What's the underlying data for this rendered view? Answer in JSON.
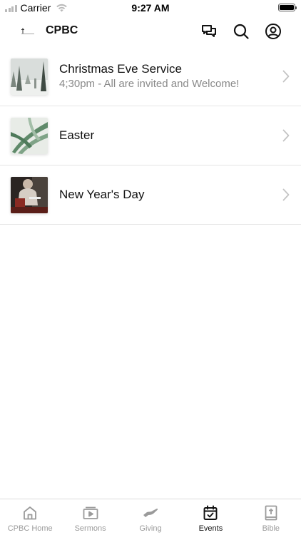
{
  "status_bar": {
    "carrier": "Carrier",
    "time": "9:27 AM"
  },
  "header": {
    "logo_text": "CPBC",
    "title": "CPBC"
  },
  "events": [
    {
      "title": "Christmas Eve Service",
      "subtitle": "4;30pm - All are invited and Welcome!",
      "thumbnail": "snowy-forest"
    },
    {
      "title": "Easter",
      "subtitle": "",
      "thumbnail": "palm-leaves"
    },
    {
      "title": "New Year's Day",
      "subtitle": "",
      "thumbnail": "person-reading"
    }
  ],
  "tabs": [
    {
      "label": "CPBC Home",
      "icon": "home-icon",
      "active": false
    },
    {
      "label": "Sermons",
      "icon": "video-icon",
      "active": false
    },
    {
      "label": "Giving",
      "icon": "hand-icon",
      "active": false
    },
    {
      "label": "Events",
      "icon": "calendar-icon",
      "active": true
    },
    {
      "label": "Bible",
      "icon": "bible-icon",
      "active": false
    }
  ],
  "colors": {
    "active_tab": "#111111",
    "inactive_tab": "#9a9a9a",
    "subtitle": "#8a8a8a",
    "divider": "#e5e5e5"
  }
}
